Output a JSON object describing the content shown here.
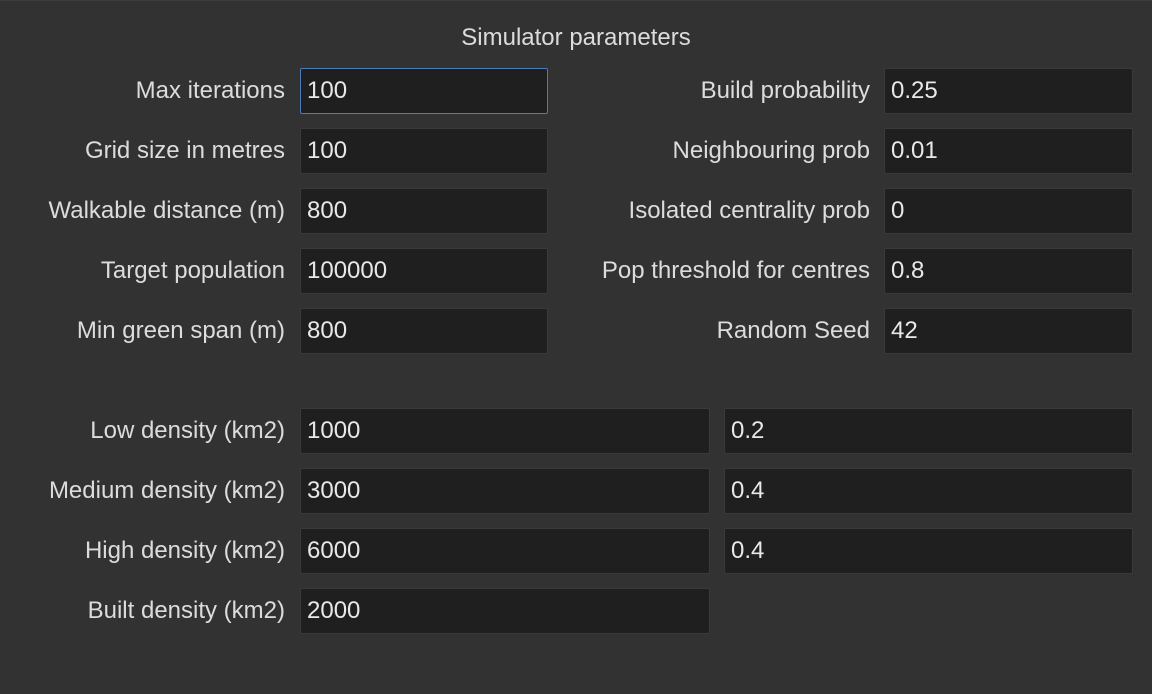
{
  "title": "Simulator parameters",
  "left_params": [
    {
      "label": "Max iterations",
      "value": "100"
    },
    {
      "label": "Grid size in metres",
      "value": "100"
    },
    {
      "label": "Walkable distance (m)",
      "value": "800"
    },
    {
      "label": "Target population",
      "value": "100000"
    },
    {
      "label": "Min green span (m)",
      "value": "800"
    }
  ],
  "right_params": [
    {
      "label": "Build probability",
      "value": "0.25"
    },
    {
      "label": "Neighbouring prob",
      "value": "0.01"
    },
    {
      "label": "Isolated centrality prob",
      "value": "0"
    },
    {
      "label": "Pop threshold for centres",
      "value": "0.8"
    },
    {
      "label": "Random Seed",
      "value": "42"
    }
  ],
  "density_params": [
    {
      "label": "Low density (km2)",
      "value": "1000",
      "ratio": "0.2"
    },
    {
      "label": "Medium density (km2)",
      "value": "3000",
      "ratio": "0.4"
    },
    {
      "label": "High density (km2)",
      "value": "6000",
      "ratio": "0.4"
    },
    {
      "label": "Built density (km2)",
      "value": "2000"
    }
  ],
  "colors": {
    "background": "#323232",
    "field_background": "#1f1f1f",
    "text": "#dcdcdc",
    "focus_border": "#4c7bb8"
  }
}
